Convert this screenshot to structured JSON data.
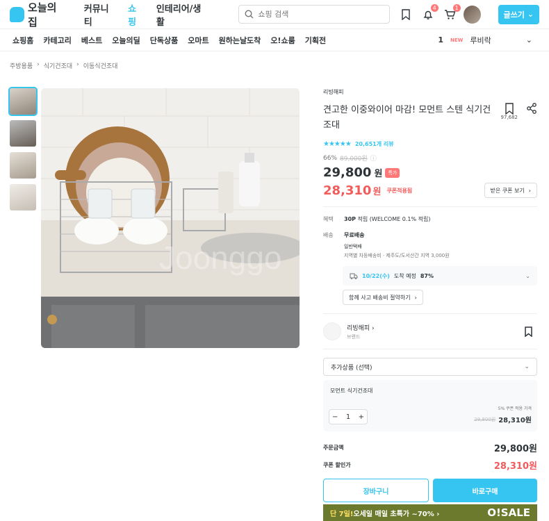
{
  "header": {
    "logo": "오늘의집",
    "nav": [
      "커뮤니티",
      "쇼핑",
      "인테리어/생활"
    ],
    "search_placeholder": "쇼핑 검색",
    "badges": {
      "bell": "4",
      "cart": "1"
    },
    "write_label": "글쓰기"
  },
  "subnav": {
    "items": [
      "쇼핑홈",
      "카테고리",
      "베스트",
      "오늘의딜",
      "단독상품",
      "오마트",
      "원하는날도착",
      "오!쇼룸",
      "기획전"
    ],
    "rank_num": "1",
    "rank_new": "NEW",
    "rank_keyword": "루비락"
  },
  "breadcrumb": [
    "주방용품",
    "식기건조대",
    "이동식건조대"
  ],
  "product": {
    "brand": "리빙해피",
    "title": "견고한 이중와이어 마감! 모먼트 스텐 식기건조대",
    "scrap_count": "97,682",
    "rating_stars": "★★★★★",
    "review_count": "20,651개 리뷰",
    "discount_rate": "66%",
    "orig_price": "89,000원",
    "price": "29,800",
    "won": "원",
    "special_badge": "특가",
    "coupon_price": "28,310",
    "coupon_tag": "쿠폰적용됨",
    "coupon_btn": "받은 쿠폰 보기"
  },
  "benefit": {
    "label": "혜택",
    "value": "30P",
    "value_rest": " 적립 (WELCOME 0.1% 적립)"
  },
  "shipping": {
    "label": "배송",
    "free": "무료배송",
    "type": "일반택배",
    "note": "지역별 차등배송비 · 제주도/도서산간 지역 3,000원",
    "date": "10/22(수)",
    "date_rest": "도착 예정",
    "rate": "87%",
    "bundle_btn": "함께 사고 배송비 절약하기"
  },
  "seller": {
    "name": "리빙해피",
    "sub": "브랜드"
  },
  "options": {
    "select_label": "추가상품 (선택)",
    "item_name": "모먼트 식기건조대",
    "qty": "1",
    "price_note": "5% 쿠폰 적용 가격",
    "orig": "29,800원",
    "final": "28,310원"
  },
  "total": {
    "order_label": "주문금액",
    "order_value": "29,800원",
    "coupon_label": "쿠폰 할인가",
    "coupon_value": "28,310원"
  },
  "actions": {
    "cart": "장바구니",
    "buy": "바로구매"
  },
  "banner": {
    "highlight": "단 7일!",
    "text": " 오세일 매일 초특가 ~70% ›",
    "logo": "O!SALE"
  },
  "colors": {
    "accent": "#35c5f0",
    "sale": "#f25b5b"
  }
}
